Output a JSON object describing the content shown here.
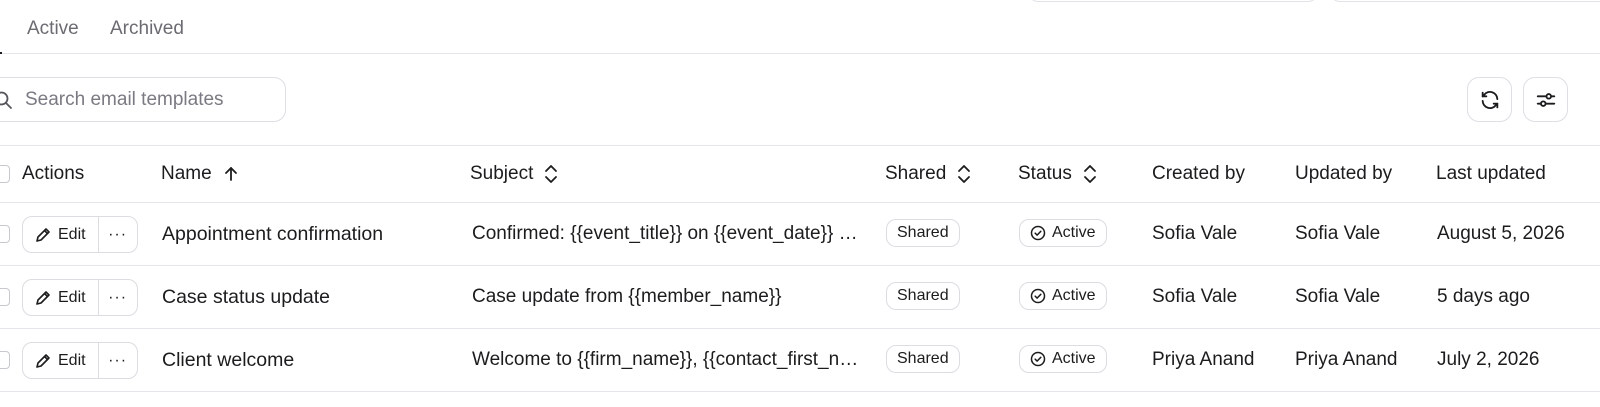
{
  "tabs": {
    "active_label": "Active",
    "archived_label": "Archived"
  },
  "search": {
    "placeholder": "Search email templates",
    "value": ""
  },
  "table": {
    "headers": {
      "actions": "Actions",
      "name": "Name",
      "subject": "Subject",
      "shared": "Shared",
      "status": "Status",
      "created_by": "Created by",
      "updated_by": "Updated by",
      "last_updated": "Last updated"
    },
    "rows": [
      {
        "edit_label": "Edit",
        "more_label": "···",
        "name": "Appointment confirmation",
        "subject": "Confirmed: {{event_title}} on {{event_date}} at {{event_time}}",
        "shared": "Shared",
        "status": "Active",
        "created_by": "Sofia Vale",
        "updated_by": "Sofia Vale",
        "last_updated": "August 5, 2026"
      },
      {
        "edit_label": "Edit",
        "more_label": "···",
        "name": "Case status update",
        "subject": "Case update from {{member_name}}",
        "shared": "Shared",
        "status": "Active",
        "created_by": "Sofia Vale",
        "updated_by": "Sofia Vale",
        "last_updated": "5 days ago"
      },
      {
        "edit_label": "Edit",
        "more_label": "···",
        "name": "Client welcome",
        "subject": "Welcome to {{firm_name}}, {{contact_first_name}}",
        "shared": "Shared",
        "status": "Active",
        "created_by": "Priya Anand",
        "updated_by": "Priya Anand",
        "last_updated": "July 2, 2026"
      }
    ]
  },
  "icons": {
    "search": "search-icon",
    "refresh": "refresh-icon",
    "filters": "sliders-icon",
    "sort_asc": "arrow-up-icon",
    "sort_both": "chevron-up-down-icon",
    "edit": "pencil-icon",
    "status": "check-circle-icon"
  }
}
